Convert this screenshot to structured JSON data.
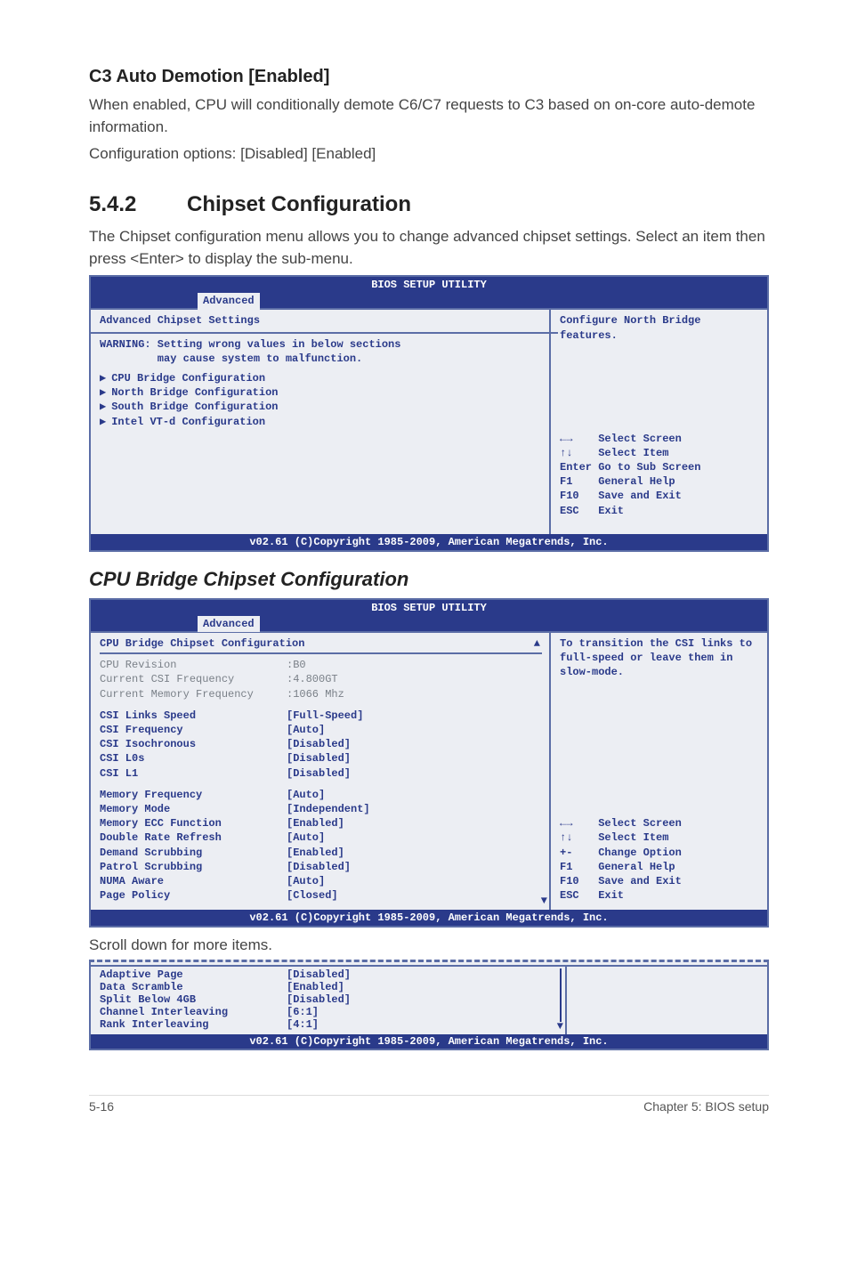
{
  "section_c3": {
    "title": "C3 Auto Demotion [Enabled]",
    "p1": "When enabled, CPU will conditionally demote C6/C7 requests to C3 based on on-core auto-demote information.",
    "p2": "Configuration options: [Disabled] [Enabled]"
  },
  "section_542": {
    "number": "5.4.2",
    "title": "Chipset Configuration",
    "p1": "The Chipset configuration menu allows you to change advanced chipset settings. Select an item then press <Enter> to display the sub-menu."
  },
  "bios1": {
    "title": "BIOS SETUP UTILITY",
    "tab": "Advanced",
    "heading": "Advanced Chipset Settings",
    "warning_l1": "WARNING: Setting wrong values in below sections",
    "warning_l2": "         may cause system to malfunction.",
    "items": [
      "CPU Bridge Configuration",
      "North Bridge Configuration",
      "South Bridge Configuration",
      "Intel VT-d Configuration"
    ],
    "help_top": "Configure North Bridge features.",
    "keys": [
      "←→    Select Screen",
      "↑↓    Select Item",
      "Enter Go to Sub Screen",
      "F1    General Help",
      "F10   Save and Exit",
      "ESC   Exit"
    ],
    "footer": "v02.61 (C)Copyright 1985-2009, American Megatrends, Inc."
  },
  "section_cpu_bridge": {
    "title": "CPU Bridge Chipset Configuration"
  },
  "bios2": {
    "title": "BIOS SETUP UTILITY",
    "tab": "Advanced",
    "heading": "CPU Bridge Chipset Configuration",
    "info": [
      {
        "label": "CPU Revision",
        "value": ":B0"
      },
      {
        "label": "Current CSI Frequency",
        "value": ":4.800GT"
      },
      {
        "label": "Current Memory Frequency",
        "value": ":1066 Mhz"
      }
    ],
    "group1": [
      {
        "label": "CSI Links Speed",
        "value": "[Full-Speed]"
      },
      {
        "label": "CSI Frequency",
        "value": "[Auto]"
      },
      {
        "label": "CSI Isochronous",
        "value": "[Disabled]"
      },
      {
        "label": "CSI L0s",
        "value": "[Disabled]"
      },
      {
        "label": "CSI L1",
        "value": "[Disabled]"
      }
    ],
    "group2": [
      {
        "label": "Memory Frequency",
        "value": "[Auto]"
      },
      {
        "label": "Memory Mode",
        "value": "[Independent]"
      },
      {
        "label": "Memory ECC Function",
        "value": "[Enabled]"
      },
      {
        "label": "Double Rate Refresh",
        "value": "[Auto]"
      },
      {
        "label": "Demand Scrubbing",
        "value": "[Enabled]"
      },
      {
        "label": "Patrol Scrubbing",
        "value": "[Disabled]"
      },
      {
        "label": "NUMA Aware",
        "value": "[Auto]"
      },
      {
        "label": "Page Policy",
        "value": "[Closed]"
      }
    ],
    "help_top": "To transition the CSI links to full-speed or leave them in slow-mode.",
    "keys": [
      "←→    Select Screen",
      "↑↓    Select Item",
      "+-    Change Option",
      "F1    General Help",
      "F10   Save and Exit",
      "ESC   Exit"
    ],
    "footer": "v02.61 (C)Copyright 1985-2009, American Megatrends, Inc."
  },
  "scroll_note": "Scroll down for more items.",
  "bios3": {
    "items": [
      {
        "label": "Adaptive Page",
        "value": "[Disabled]"
      },
      {
        "label": "Data Scramble",
        "value": "[Enabled]"
      },
      {
        "label": "Split Below 4GB",
        "value": "[Disabled]"
      },
      {
        "label": "Channel Interleaving",
        "value": "[6:1]"
      },
      {
        "label": "Rank Interleaving",
        "value": "[4:1]"
      }
    ],
    "footer": "v02.61 (C)Copyright 1985-2009, American Megatrends, Inc."
  },
  "footer": {
    "left": "5-16",
    "right": "Chapter 5: BIOS setup"
  }
}
